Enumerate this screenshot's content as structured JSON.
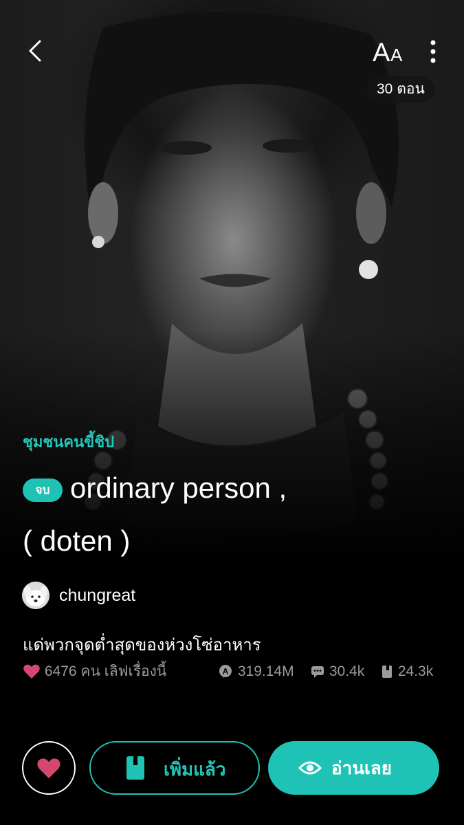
{
  "header": {
    "back_icon": "chevron-left-icon",
    "font_icon": "font-size-icon",
    "more_icon": "more-vertical-icon",
    "episodes_label": "30 ตอน"
  },
  "cover": {
    "description_icon": "cover-photo"
  },
  "story": {
    "category": "ชุมชนคนขี้ชิป",
    "status_badge": "จบ",
    "title_line1": "ordinary person ,",
    "title_line2": "( doten )",
    "author": "chungreat",
    "tagline": "แด่พวกจุดต่ำสุดของห่วงโซ่อาหาร"
  },
  "stats": {
    "loves": "6476 คน เลิฟเรื่องนี้",
    "views": "319.14M",
    "comments": "30.4k",
    "bookmarks": "24.3k"
  },
  "actions": {
    "love_icon": "heart-icon",
    "add_label": "เพิ่มแล้ว",
    "read_label": "อ่านเลย"
  },
  "colors": {
    "accent": "#1fc3b5",
    "heart": "#d4486f",
    "muted": "#9a9a9a"
  }
}
